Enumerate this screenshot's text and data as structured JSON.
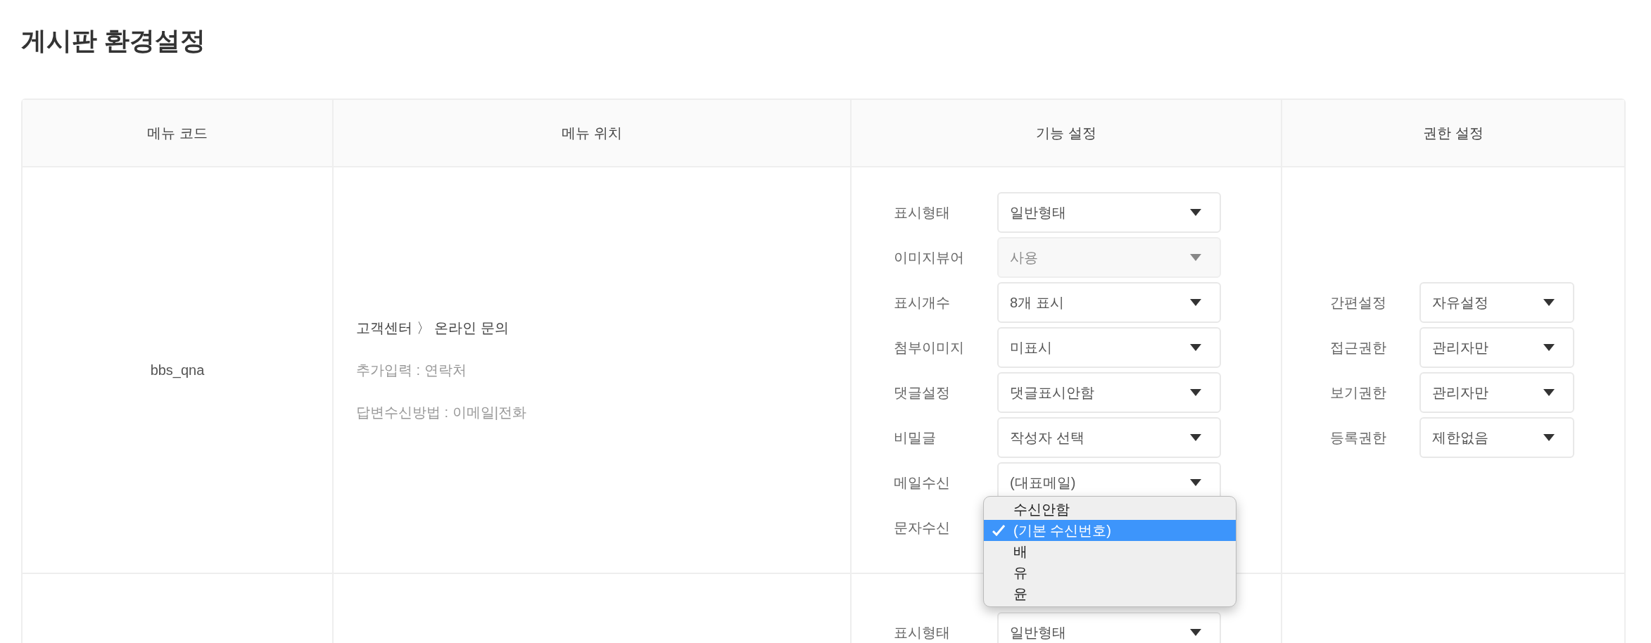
{
  "page_title": "게시판 환경설정",
  "table": {
    "columns": [
      "메뉴 코드",
      "메뉴 위치",
      "기능 설정",
      "권한 설정"
    ],
    "rows": [
      {
        "menu_code": "bbs_qna",
        "menu_location": {
          "path": "고객센터 〉 온라인 문의",
          "details": [
            "추가입력 : 연락처",
            "답변수신방법 : 이메일|전화"
          ]
        },
        "features": [
          {
            "kind": "select",
            "label": "표시형태",
            "value": "일반형태",
            "disabled": false
          },
          {
            "kind": "select",
            "label": "이미지뷰어",
            "value": "사용",
            "disabled": true
          },
          {
            "kind": "select",
            "label": "표시개수",
            "value": "8개 표시",
            "disabled": false
          },
          {
            "kind": "select",
            "label": "첨부이미지",
            "value": "미표시",
            "disabled": false
          },
          {
            "kind": "select",
            "label": "댓글설정",
            "value": "댓글표시안함",
            "disabled": false
          },
          {
            "kind": "select",
            "label": "비밀글",
            "value": "작성자 선택",
            "disabled": false
          },
          {
            "kind": "select",
            "label": "메일수신",
            "value": "(대표메일)",
            "disabled": false
          },
          {
            "kind": "open",
            "label": "문자수신",
            "options": [
              {
                "label": "수신안함",
                "selected": false
              },
              {
                "label": "(기본 수신번호)",
                "selected": true
              },
              {
                "label": "배",
                "selected": false
              },
              {
                "label": "유",
                "selected": false
              },
              {
                "label": "윤",
                "selected": false
              }
            ]
          }
        ],
        "permissions": [
          {
            "label": "간편설정",
            "value": "자유설정"
          },
          {
            "label": "접근권한",
            "value": "관리자만"
          },
          {
            "label": "보기권한",
            "value": "관리자만"
          },
          {
            "label": "등록권한",
            "value": "제한없음"
          }
        ]
      },
      {
        "features": [
          {
            "kind": "select",
            "label": "표시형태",
            "value": "일반형태",
            "disabled": false
          }
        ]
      }
    ]
  }
}
